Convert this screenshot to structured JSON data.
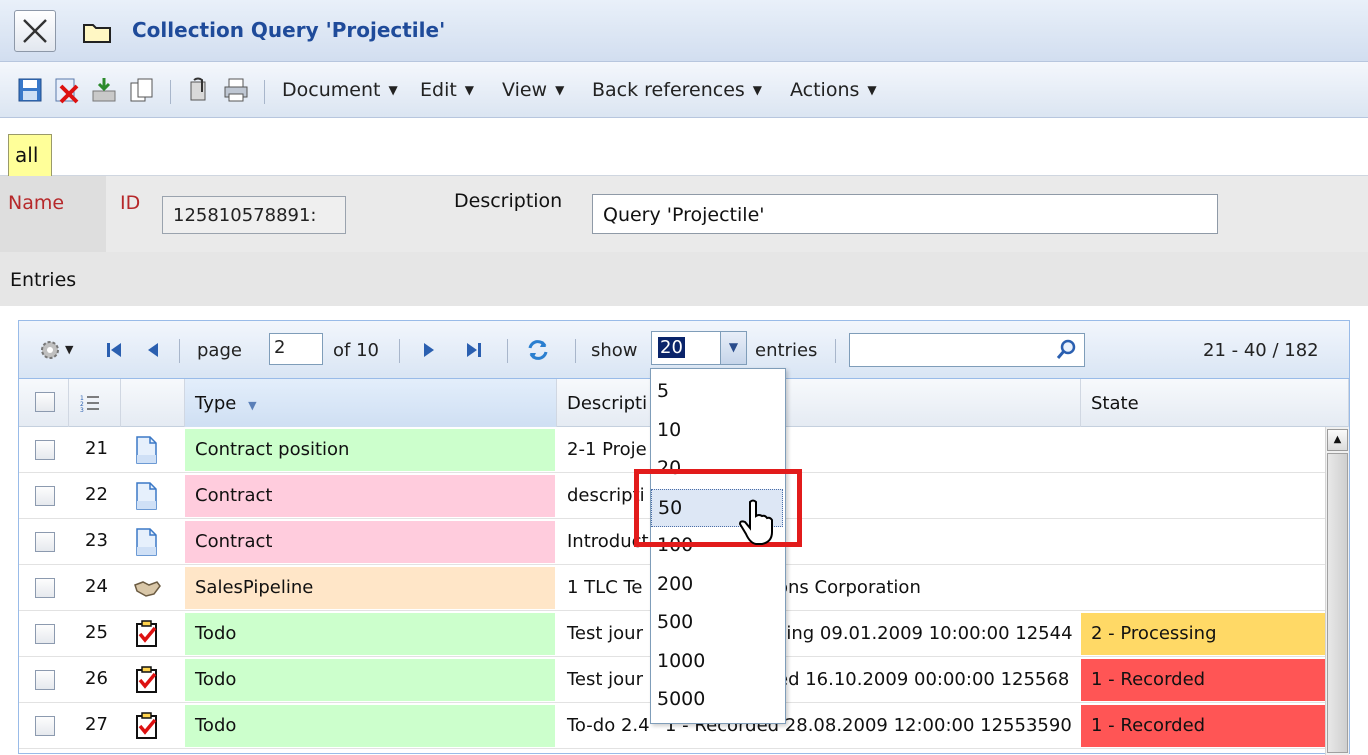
{
  "window": {
    "title": "Collection Query 'Projectile'"
  },
  "toolbar": {
    "menus": [
      "Document",
      "Edit",
      "View",
      "Back references",
      "Actions"
    ]
  },
  "tabs": {
    "active": "all"
  },
  "form": {
    "name_label": "Name",
    "id_label": "ID",
    "id_value": "125810578891:",
    "description_label": "Description",
    "description_value": "Query 'Projectile'",
    "entries_label": "Entries"
  },
  "pager": {
    "page_label": "page",
    "page_value": "2",
    "of_label": "of 10",
    "show_label": "show",
    "show_value": "20",
    "entries_label": "entries",
    "search_value": "",
    "range_label": "21 - 40 / 182"
  },
  "columns": {
    "type": "Type",
    "description": "Descripti",
    "state": "State"
  },
  "rows": [
    {
      "num": "21",
      "icon": "document-icon",
      "type": "Contract position",
      "type_color": "#ccffcc",
      "description": "2-1 Proje",
      "state": "",
      "state_color": ""
    },
    {
      "num": "22",
      "icon": "document-icon",
      "type": "Contract",
      "type_color": "#ffccdd",
      "description": "descripti",
      "state": "",
      "state_color": ""
    },
    {
      "num": "23",
      "icon": "document-icon",
      "type": "Contract",
      "type_color": "#ffccdd",
      "description": "Introduct",
      "state": "",
      "state_color": ""
    },
    {
      "num": "24",
      "icon": "handshake-icon",
      "type": "SalesPipeline",
      "type_color": "#ffe6c8",
      "description": "1 TLC Te",
      "description_tail": "ons Corporation",
      "state": "",
      "state_color": ""
    },
    {
      "num": "25",
      "icon": "todo-icon",
      "type": "Todo",
      "type_color": "#ccffcc",
      "description": "Test jour",
      "description_tail": "sing 09.01.2009 10:00:00 12544",
      "state": "2 - Processing",
      "state_color": "#ffd966"
    },
    {
      "num": "26",
      "icon": "todo-icon",
      "type": "Todo",
      "type_color": "#ccffcc",
      "description": "Test jour",
      "description_tail": "ed 16.10.2009 00:00:00 125568",
      "state": "1 - Recorded",
      "state_color": "#ff5555"
    },
    {
      "num": "27",
      "icon": "todo-icon",
      "type": "Todo",
      "type_color": "#ccffcc",
      "description": "To-do 2.4",
      "description_tail": "1 - Recorded 28.08.2009 12:00:00 12553590",
      "state": "1 - Recorded",
      "state_color": "#ff5555"
    }
  ],
  "dropdown": {
    "options": [
      "5",
      "10",
      "20",
      "50",
      "100",
      "200",
      "500",
      "1000",
      "5000"
    ],
    "hovered": "50"
  }
}
